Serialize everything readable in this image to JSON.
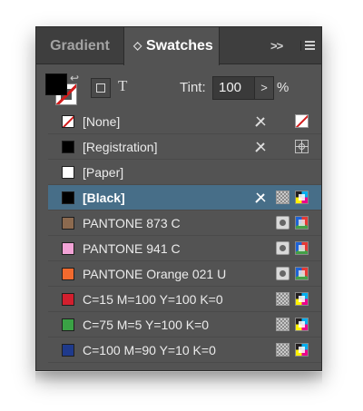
{
  "tabs": [
    {
      "label": "Gradient",
      "active": false
    },
    {
      "label": "Swatches",
      "active": true
    }
  ],
  "tab_chevron": "◇",
  "header_icons": {
    "expand": ">>",
    "menu": "panel-menu-icon"
  },
  "toolbar": {
    "fill_color": "#000000",
    "stroke": "none",
    "text_toggle": "T",
    "tint_label": "Tint:",
    "tint_value": "100",
    "tint_stepper": ">",
    "tint_unit": "%"
  },
  "swatches": [
    {
      "name": "[None]",
      "color": "none",
      "icons": [
        "pencil-lock-icon",
        "none-icon"
      ]
    },
    {
      "name": "[Registration]",
      "color": "#000000",
      "icons": [
        "pencil-lock-icon",
        "registration-icon"
      ]
    },
    {
      "name": "[Paper]",
      "color": "#ffffff",
      "icons": []
    },
    {
      "name": "[Black]",
      "color": "#000000",
      "selected": true,
      "icons": [
        "pencil-lock-icon",
        "process-icon",
        "cmyk-icon"
      ]
    },
    {
      "name": "PANTONE 873 C",
      "color": "#8c6a4f",
      "icons": [
        "spot-icon",
        "rgb-icon"
      ]
    },
    {
      "name": "PANTONE 941 C",
      "color": "#f2a3d6",
      "icons": [
        "spot-icon",
        "rgb-icon"
      ]
    },
    {
      "name": "PANTONE Orange 021 U",
      "color": "#f26a2e",
      "icons": [
        "spot-icon",
        "rgb-icon"
      ]
    },
    {
      "name": "C=15 M=100 Y=100 K=0",
      "color": "#d21f2e",
      "icons": [
        "process-icon",
        "cmyk-icon"
      ]
    },
    {
      "name": "C=75 M=5 Y=100 K=0",
      "color": "#3aa245",
      "icons": [
        "process-icon",
        "cmyk-icon"
      ]
    },
    {
      "name": "C=100 M=90 Y=10 K=0",
      "color": "#1f3a8c",
      "icons": [
        "process-icon",
        "cmyk-icon"
      ]
    }
  ]
}
